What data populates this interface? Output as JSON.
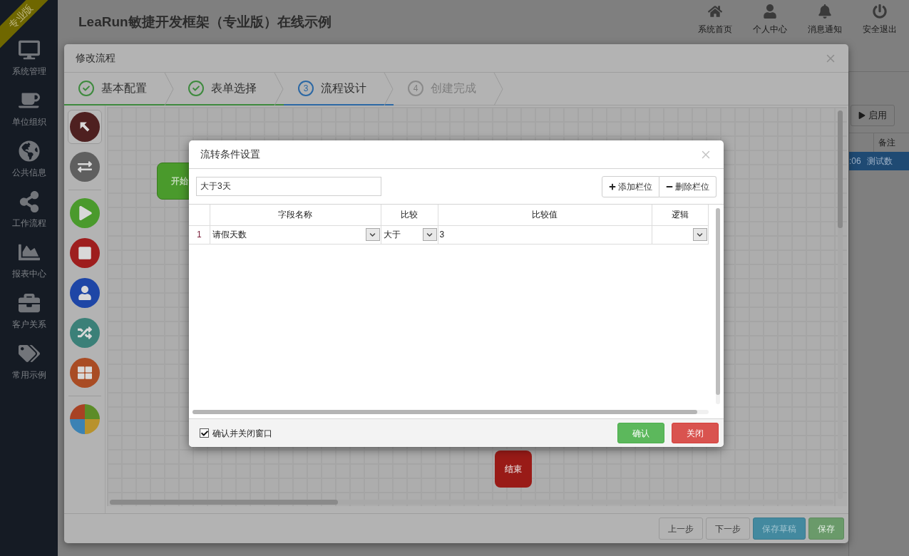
{
  "sidebar": {
    "badge": "专业版",
    "items": [
      {
        "label": "系统管理"
      },
      {
        "label": "单位组织"
      },
      {
        "label": "公共信息"
      },
      {
        "label": "工作流程"
      },
      {
        "label": "报表中心"
      },
      {
        "label": "客户关系"
      },
      {
        "label": "常用示例"
      }
    ]
  },
  "header": {
    "title": "LeaRun敏捷开发框架（专业版）在线示例",
    "nav": [
      "系统首页",
      "个人中心",
      "消息通知",
      "安全退出"
    ]
  },
  "background_panel": {
    "button": "启用",
    "column": "备注",
    "row": {
      "selected": true,
      "cells": [
        ":06",
        "测试数"
      ]
    }
  },
  "flow_modal": {
    "title": "修改流程",
    "steps": [
      {
        "label": "基本配置",
        "kind": "done"
      },
      {
        "label": "表单选择",
        "kind": "done"
      },
      {
        "label": "流程设计",
        "kind": "current",
        "number": "3"
      },
      {
        "label": "创建完成",
        "kind": "pending",
        "number": "4"
      }
    ],
    "tools": [
      {
        "selected": true,
        "color": "#4e2020"
      },
      {
        "selected": false,
        "color": "#5f5f5f"
      },
      {
        "selected": false,
        "color": "#4a9a2c"
      },
      {
        "selected": false,
        "color": "#9e1e1e"
      },
      {
        "selected": false,
        "color": "#1e46a6"
      },
      {
        "selected": false,
        "color": "#3b8078"
      },
      {
        "selected": false,
        "color": "#a94c24"
      },
      {
        "selected": false,
        "kind": "multi"
      }
    ],
    "nodes": [
      {
        "label": "开始",
        "kind": "start"
      },
      {
        "label": "结束",
        "kind": "end"
      }
    ],
    "buttons": [
      {
        "label": "上一步",
        "kind": "default"
      },
      {
        "label": "下一步",
        "kind": "default"
      },
      {
        "label": "保存草稿",
        "kind": "info"
      },
      {
        "label": "保存",
        "kind": "success"
      }
    ]
  },
  "condition_dialog": {
    "title": "流转条件设置",
    "name_field": {
      "value": "大于3天"
    },
    "actions": [
      {
        "label": "添加栏位",
        "kind": "add"
      },
      {
        "label": "删除栏位",
        "kind": "remove"
      }
    ],
    "columns": [
      "字段名称",
      "比较",
      "比较值",
      "逻辑"
    ],
    "rows": [
      {
        "index": "1",
        "field": "请假天数",
        "compare": "大于",
        "value": "3"
      }
    ],
    "confirm_close": {
      "label": "确认并关闭窗口",
      "checked": true
    },
    "buttons": [
      {
        "label": "确认",
        "kind": "primary"
      },
      {
        "label": "关闭",
        "kind": "danger"
      }
    ]
  }
}
